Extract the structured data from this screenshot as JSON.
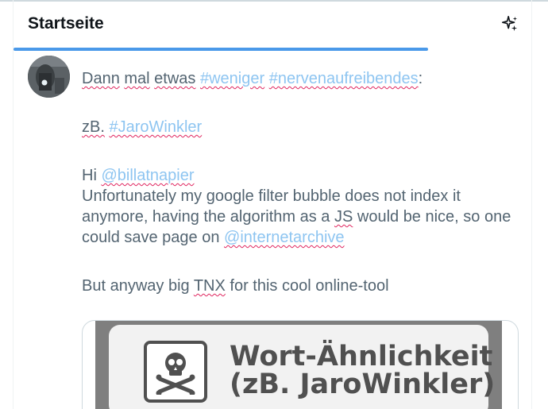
{
  "header": {
    "title": "Startseite",
    "sparkle_icon": "sparkle-icon"
  },
  "tweet": {
    "avatar_icon": "user-avatar",
    "line1": {
      "words": [
        "Dann",
        "mal",
        "etwas"
      ],
      "tag1": "#weniger",
      "tag2": "#nervenaufreibendes",
      "colon": ":"
    },
    "line2": {
      "prefix": "zB.",
      "tag": "#JaroWinkler"
    },
    "para3": {
      "hi": "Hi",
      "mention": "@billatnapier",
      "text_a": "Unfortunately my google filter bubble does not index it anymore, having the algorithm as a",
      "js": "JS",
      "text_b": "would be nice, so one could save page on",
      "mention2": "@internetarchive"
    },
    "para4": {
      "text_a": "But anyway big",
      "tnx": "TNX",
      "text_b": "for this cool online-tool"
    },
    "media": {
      "line1": "Wort-Ähnlichkeit",
      "line2": "(zB. JaroWinkler)",
      "icon": "skull-crossbones-icon"
    }
  },
  "colors": {
    "accent": "#4a99e9",
    "link": "#8ec5f1",
    "text": "#536471",
    "spellcheck": "#e0245e"
  }
}
